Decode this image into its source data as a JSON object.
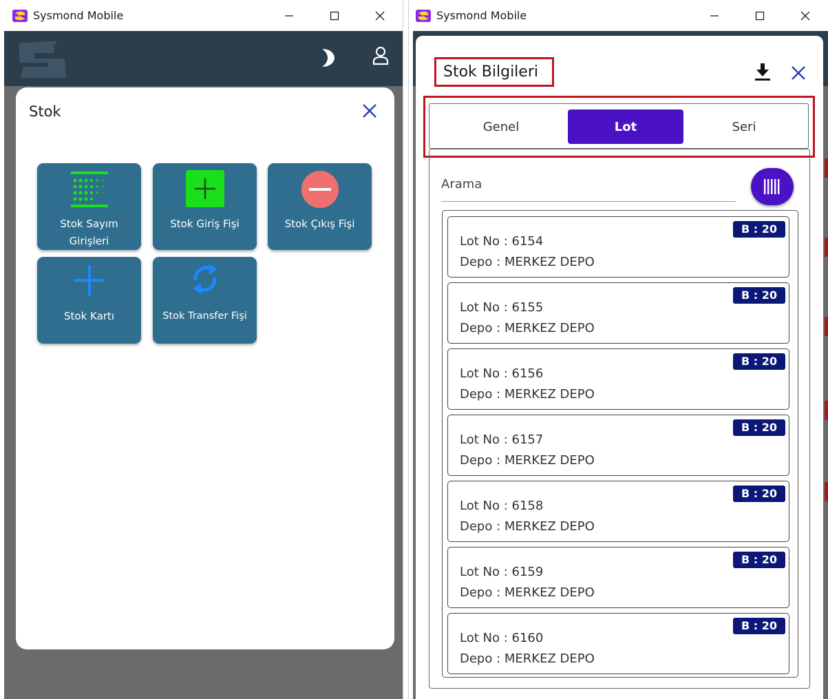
{
  "windows": {
    "left": {
      "title": "Sysmond Mobile",
      "controls": [
        "minimize-icon",
        "maximize-icon",
        "close-icon"
      ],
      "appbar_icons": [
        "moon-icon",
        "user-icon"
      ],
      "dialog": {
        "title": "Stok",
        "tiles": [
          {
            "label_lines": [
              "Stok Sayım",
              "Girişleri"
            ],
            "icon": "grid-dots-icon",
            "icon_color": "#19e019"
          },
          {
            "label_lines": [
              "Stok Giriş Fişi"
            ],
            "icon": "plus-square-icon",
            "icon_color": "#19e019"
          },
          {
            "label_lines": [
              "Stok Çıkış Fişi"
            ],
            "icon": "minus-circle-icon",
            "icon_color": "#f07070"
          },
          {
            "label_lines": [
              "Stok Kartı"
            ],
            "icon": "plus-icon",
            "icon_color": "#1e88ff"
          },
          {
            "label_lines": [
              "Stok Transfer Fişi"
            ],
            "icon": "sync-icon",
            "icon_color": "#1e88ff"
          }
        ]
      }
    },
    "right": {
      "title": "Sysmond Mobile",
      "dialog": {
        "title": "Stok Bilgileri",
        "tabs": [
          {
            "label": "Genel",
            "active": false
          },
          {
            "label": "Lot",
            "active": true
          },
          {
            "label": "Seri",
            "active": false
          }
        ],
        "search_label": "Arama",
        "lots": [
          {
            "lot": "Lot No : 6154",
            "depo": "Depo : MERKEZ DEPO",
            "badge": "B : 20"
          },
          {
            "lot": "Lot No : 6155",
            "depo": "Depo : MERKEZ DEPO",
            "badge": "B : 20"
          },
          {
            "lot": "Lot No : 6156",
            "depo": "Depo : MERKEZ DEPO",
            "badge": "B : 20"
          },
          {
            "lot": "Lot No : 6157",
            "depo": "Depo : MERKEZ DEPO",
            "badge": "B : 20"
          },
          {
            "lot": "Lot No : 6158",
            "depo": "Depo : MERKEZ DEPO",
            "badge": "B : 20"
          },
          {
            "lot": "Lot No : 6159",
            "depo": "Depo : MERKEZ DEPO",
            "badge": "B : 20"
          },
          {
            "lot": "Lot No : 6160",
            "depo": "Depo : MERKEZ DEPO",
            "badge": "B : 20"
          }
        ]
      }
    }
  },
  "colors": {
    "appbar": "#2c3d4c",
    "backdrop": "#6b6b6b",
    "tile": "#2f6e8f",
    "accent_purple": "#4a12c4",
    "badge_navy": "#0c1877",
    "highlight_red": "#c0141c",
    "close_blue": "#2b3fb0"
  }
}
